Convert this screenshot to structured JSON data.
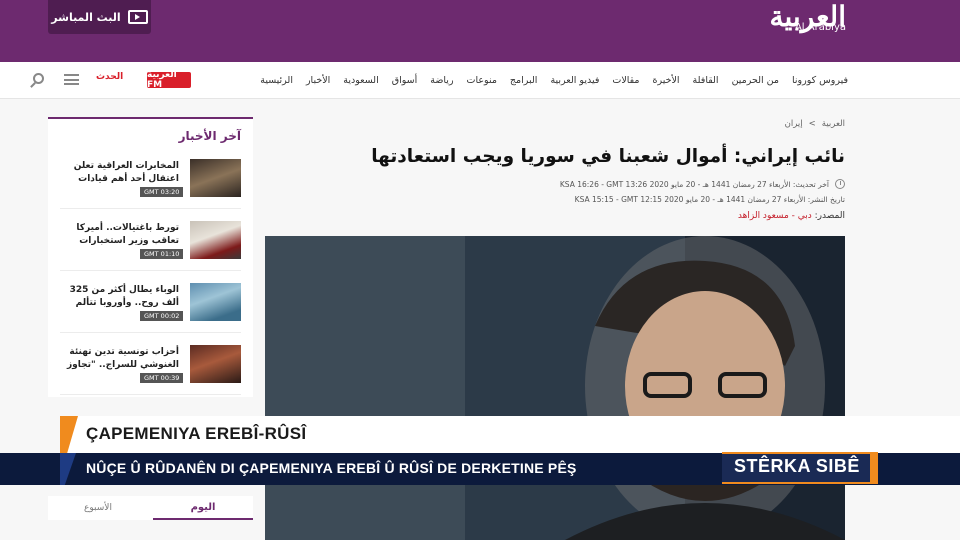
{
  "header": {
    "live_label": "البث المباشر",
    "logo_text": "العربية",
    "logo_subtitle": "Al Arabiya"
  },
  "nav": {
    "items": [
      "الرئيسية",
      "الأخبار",
      "السعودية",
      "أسواق",
      "رياضة",
      "منوعات",
      "البرامج",
      "فيديو العربية",
      "مقالات",
      "الأخيرة",
      "القافلة",
      "من الحرمين",
      "فيروس كورونا"
    ],
    "fm_label": "العربية FM",
    "hadath_label": "الحدث"
  },
  "sidebar": {
    "title": "آخر الأخبار",
    "items": [
      {
        "text": "المخابرات العراقية تعلن اعتقال أحد أهم قيادات داعش",
        "time": "GMT 03:20"
      },
      {
        "text": "تورط باغتيالات.. أميركا تعاقب وزير استخبارات إيران ...",
        "time": "GMT 01:10"
      },
      {
        "text": "الوباء يطال أكثر من 325 ألف روح.. وأوروبا تتألم",
        "time": "GMT 00:02"
      },
      {
        "text": "أحزاب تونسية تدين تهنئة الغنوشي للسراج.. \"تجاوز للدولة\"",
        "time": "GMT 00:39"
      }
    ],
    "tab_today": "اليوم",
    "tab_week": "الأسبوع"
  },
  "article": {
    "breadcrumb": [
      "العربية",
      ">",
      "إيران"
    ],
    "headline": "نائب إيراني: أموال شعبنا في سوريا ويجب استعادتها",
    "updated": "آخر تحديث: الأربعاء 27 رمضان 1441 هـ - 20 مايو 2020 KSA 16:26 - GMT 13:26",
    "published": "تاريخ النشر: الأربعاء 27 رمضان 1441 هـ - 20 مايو 2020 KSA 15:15 - GMT 12:15",
    "source_label": "المصدر:",
    "source_value": "دبي - مسعود الزاهد"
  },
  "lower_third": {
    "title": "ÇAPEMENIYA EREBÎ-RÛSÎ",
    "subtitle": "NÛÇE Û RÛDANÊN DI ÇAPEMENIYA EREBÎ Û RÛSÎ DE DERKETINE PÊŞ",
    "brand": "STÊRKA SIBÊ"
  },
  "colors": {
    "brand_purple": "#6d2a6f",
    "accent_orange": "#f08b1e",
    "navy": "#0c1a3c"
  }
}
